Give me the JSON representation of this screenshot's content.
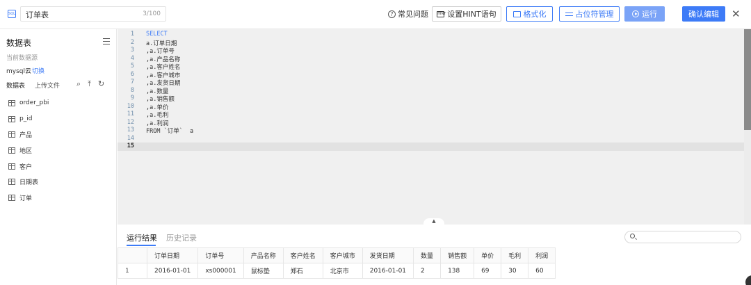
{
  "topbar": {
    "doc_icon_text": "SQL",
    "title": "订单表",
    "char_count": "3/100",
    "faq_icon": "?",
    "faq_label": "常见问题",
    "hint_icon": "HINT",
    "hint_label": "设置HINT语句",
    "format_label": "格式化",
    "placeholder_label": "占位符管理",
    "run_label": "运行",
    "confirm_label": "确认编辑",
    "close_glyph": "✕"
  },
  "sidebar": {
    "title": "数据表",
    "source_label": "当前数据源",
    "source_name": "mysql云",
    "switch_label": "切换",
    "tab_tables": "数据表",
    "tab_upload": "上传文件",
    "search_glyph": "⌕",
    "upload_glyph": "⤒",
    "refresh_glyph": "↻",
    "tables": [
      "order_pbi",
      "p_id",
      "产品",
      "地区",
      "客户",
      "日期表",
      "订单"
    ]
  },
  "editor": {
    "lines": [
      {
        "n": "1",
        "text": "SELECT",
        "kw": true
      },
      {
        "n": "2",
        "text": "a.订单日期",
        "kw": false
      },
      {
        "n": "3",
        "text": ",a.订单号",
        "kw": false
      },
      {
        "n": "4",
        "text": ",a.产品名称",
        "kw": false
      },
      {
        "n": "5",
        "text": ",a.客户姓名",
        "kw": false
      },
      {
        "n": "6",
        "text": ",a.客户城市",
        "kw": false
      },
      {
        "n": "7",
        "text": ",a.发货日期",
        "kw": false
      },
      {
        "n": "8",
        "text": ",a.数量",
        "kw": false
      },
      {
        "n": "9",
        "text": ",a.销售额",
        "kw": false
      },
      {
        "n": "10",
        "text": ",a.单价",
        "kw": false
      },
      {
        "n": "11",
        "text": ",a.毛利",
        "kw": false
      },
      {
        "n": "12",
        "text": ",a.利润",
        "kw": false
      },
      {
        "n": "13",
        "text": "FROM `订单`  a",
        "kw": false
      },
      {
        "n": "14",
        "text": "",
        "kw": false
      },
      {
        "n": "15",
        "text": "",
        "kw": false
      }
    ],
    "active_line": 15,
    "collapse_glyph": "▲"
  },
  "results": {
    "tab_run": "运行结果",
    "tab_history": "历史记录",
    "search_placeholder": "",
    "columns": [
      "",
      "订单日期",
      "订单号",
      "产品名称",
      "客户姓名",
      "客户城市",
      "发货日期",
      "数量",
      "销售额",
      "单价",
      "毛利",
      "利润"
    ],
    "rows": [
      [
        "1",
        "2016-01-01",
        "xs000001",
        "鼠标垫",
        "郑石",
        "北京市",
        "2016-01-01",
        "2",
        "138",
        "69",
        "30",
        "60"
      ]
    ]
  },
  "colors": {
    "accent": "#3d7bf7",
    "run_button": "#7aa3f7",
    "editor_bg": "#f0f0f0"
  }
}
